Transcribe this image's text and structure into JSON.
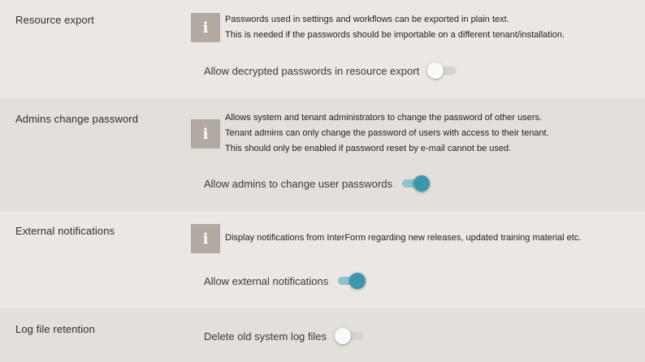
{
  "sections": [
    {
      "title": "Resource export",
      "info": [
        "Passwords used in settings and workflows can be exported in plain text.",
        "This is needed if the passwords should be importable on a different tenant/installation."
      ],
      "toggle": {
        "label": "Allow decrypted passwords in resource export",
        "state": "off"
      }
    },
    {
      "title": "Admins change password",
      "info": [
        "Allows system and tenant administrators to change the password of other users.",
        "Tenant admins can only change the password of users with access to their tenant.",
        "This should only be enabled if password reset by e-mail cannot be used."
      ],
      "toggle": {
        "label": "Allow admins to change user passwords",
        "state": "on"
      }
    },
    {
      "title": "External notifications",
      "info": [
        "Display notifications from InterForm regarding new releases, updated training material etc."
      ],
      "toggle": {
        "label": "Allow external notifications",
        "state": "on"
      }
    },
    {
      "title": "Log file retention",
      "toggle": {
        "label": "Delete old system log files",
        "state": "off"
      }
    }
  ],
  "icons": {
    "info": "info-icon"
  },
  "colors": {
    "accent": "#3b98ab",
    "info_icon_bg": "#b1a9a2"
  }
}
